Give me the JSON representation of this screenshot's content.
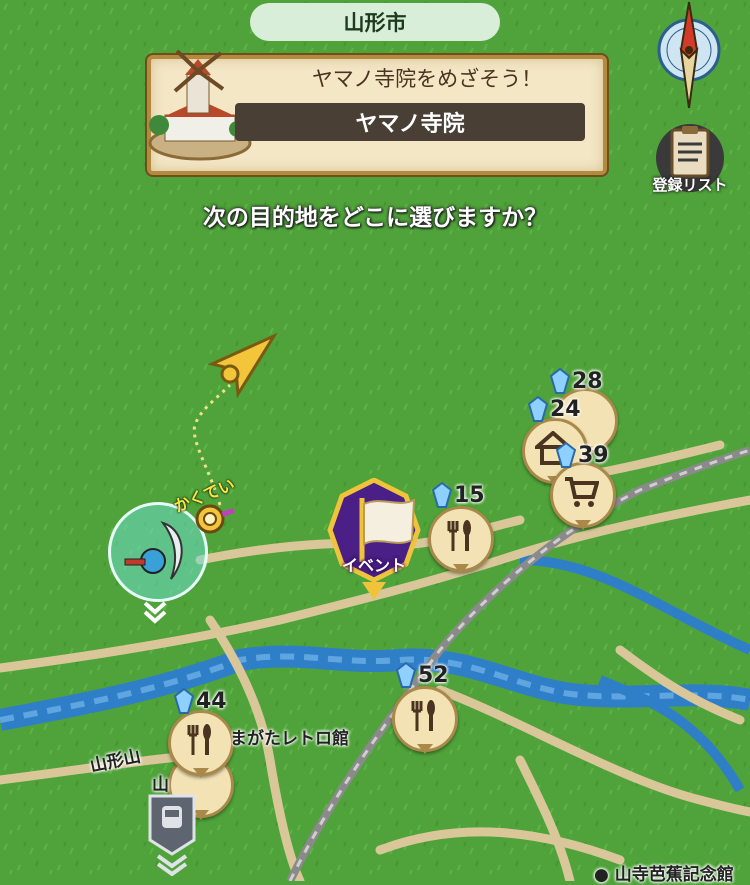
{
  "header": {
    "city": "山形市"
  },
  "banner": {
    "subtitle": "ヤマノ寺院をめざそう！",
    "destination": "ヤマノ寺院"
  },
  "prompt": {
    "question": "次の目的地をどこに選びますか？"
  },
  "controls": {
    "compass_icon": "compass-icon",
    "list_label": "登録リスト"
  },
  "player": {
    "status": "かくてい"
  },
  "event": {
    "label": "イベント"
  },
  "markers": [
    {
      "icon": "house-icon",
      "count": "28"
    },
    {
      "icon": "house-icon",
      "count": "24"
    },
    {
      "icon": "cart-icon",
      "count": "39"
    },
    {
      "icon": "restaurant-icon",
      "count": "15"
    },
    {
      "icon": "restaurant-icon",
      "count": "52"
    },
    {
      "icon": "restaurant-icon",
      "count": "44"
    }
  ],
  "places": {
    "museum": "まがたレトロ館",
    "station_line": "山形山",
    "station_short": "山",
    "memorial": "山寺芭蕉記念館"
  },
  "colors": {
    "grass": "#4fa33a",
    "river": "#2f7fc8",
    "road": "#d9c79a",
    "rail": "#8a8a8a",
    "event": "#4a1f86"
  }
}
